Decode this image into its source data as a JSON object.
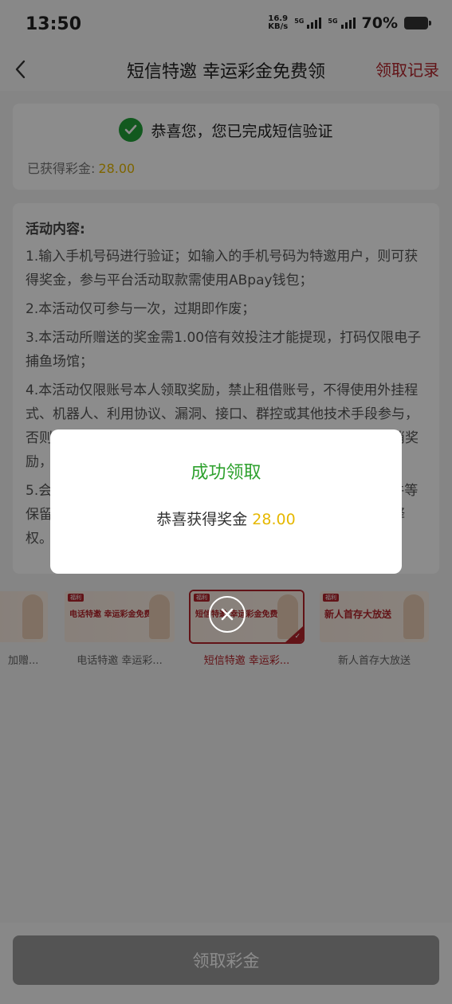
{
  "status": {
    "time": "13:50",
    "speed_value": "16.9",
    "speed_unit": "KB/s",
    "net1": "5G",
    "net2": "5G",
    "battery": "70%"
  },
  "nav": {
    "title": "短信特邀 幸运彩金免费领",
    "record_link": "领取记录"
  },
  "verify_card": {
    "message": "恭喜您，您已完成短信验证",
    "earned_label": "已获得彩金:",
    "earned_amount": "28.00"
  },
  "activity": {
    "title": "活动内容:",
    "rules": [
      "1.输入手机号码进行验证；如输入的手机号码为特邀用户，则可获得奖金，参与平台活动取款需使用ABpay钱包；",
      "2.本活动仅可参与一次，过期即作废；",
      "3.本活动所赠送的奖金需1.00倍有效投注才能提现，打码仅限电子捕鱼场馆；",
      "4.本活动仅限账号本人领取奖励，禁止租借账号，不得使用外挂程式、机器人、利用协议、漏洞、接口、群控或其他技术手段参与，否则平台有权对该账号进行审核、冻结或暂停会员账号，并取消奖励，如有疑问请联系客服，恕不个别通知；",
      "5.会员参与活动即代表同意本活动规则及条款，平台对活动条件等保留修改、停止或取消的权利，本活动规则由平台拥有最终解释权。"
    ]
  },
  "carousel": {
    "items": [
      {
        "caption": "加赠...",
        "banner_text": "",
        "selected": false
      },
      {
        "caption": "电话特邀 幸运彩...",
        "banner_text": "电话特邀 幸运彩金免费领",
        "selected": false
      },
      {
        "caption": "短信特邀 幸运彩...",
        "banner_text": "短信特邀 幸运彩金免费领",
        "selected": true
      },
      {
        "caption": "新人首存大放送",
        "banner_text": "新人首存大放送",
        "selected": false
      }
    ],
    "tag": "福利"
  },
  "bottom": {
    "claim_button": "领取彩金"
  },
  "modal": {
    "title": "成功领取",
    "message": "恭喜获得奖金",
    "amount": "28.00"
  },
  "colors": {
    "accent_red": "#b3242a",
    "success_green": "#2ea12e",
    "amount_gold": "#e6b800",
    "disabled_button": "#999999"
  }
}
